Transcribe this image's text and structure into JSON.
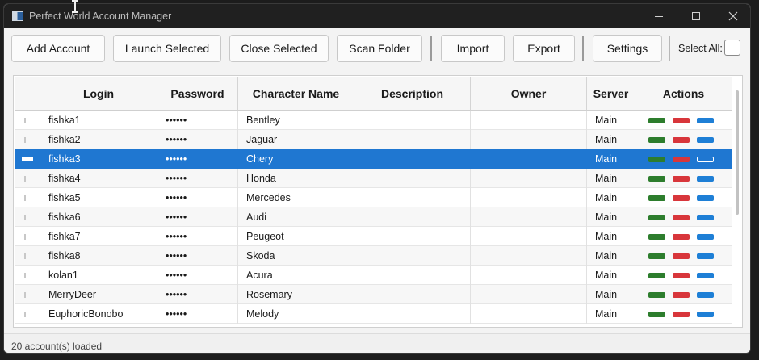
{
  "window": {
    "title": "Perfect World Account Manager"
  },
  "toolbar": {
    "add_account": "Add Account",
    "launch_selected": "Launch Selected",
    "close_selected": "Close Selected",
    "scan_folder": "Scan Folder",
    "import": "Import",
    "export": "Export",
    "settings": "Settings",
    "select_all_label": "Select All:",
    "select_all_checked": false
  },
  "table": {
    "columns": [
      "",
      "Login",
      "Password",
      "Character Name",
      "Description",
      "Owner",
      "Server",
      "Actions"
    ],
    "selected_row": 2,
    "rows": [
      {
        "login": "fishka1",
        "password": "••••••",
        "character": "Bentley",
        "description": "",
        "owner": "",
        "server": "Main"
      },
      {
        "login": "fishka2",
        "password": "••••••",
        "character": "Jaguar",
        "description": "",
        "owner": "",
        "server": "Main"
      },
      {
        "login": "fishka3",
        "password": "••••••",
        "character": "Chery",
        "description": "",
        "owner": "",
        "server": "Main"
      },
      {
        "login": "fishka4",
        "password": "••••••",
        "character": "Honda",
        "description": "",
        "owner": "",
        "server": "Main"
      },
      {
        "login": "fishka5",
        "password": "••••••",
        "character": "Mercedes",
        "description": "",
        "owner": "",
        "server": "Main"
      },
      {
        "login": "fishka6",
        "password": "••••••",
        "character": "Audi",
        "description": "",
        "owner": "",
        "server": "Main"
      },
      {
        "login": "fishka7",
        "password": "••••••",
        "character": "Peugeot",
        "description": "",
        "owner": "",
        "server": "Main"
      },
      {
        "login": "fishka8",
        "password": "••••••",
        "character": "Skoda",
        "description": "",
        "owner": "",
        "server": "Main"
      },
      {
        "login": "kolan1",
        "password": "••••••",
        "character": "Acura",
        "description": "",
        "owner": "",
        "server": "Main"
      },
      {
        "login": "MerryDeer",
        "password": "••••••",
        "character": "Rosemary",
        "description": "",
        "owner": "",
        "server": "Main"
      },
      {
        "login": "EuphoricBonobo",
        "password": "••••••",
        "character": "Melody",
        "description": "",
        "owner": "",
        "server": "Main"
      }
    ],
    "action_colors": {
      "launch": "#2d7d2d",
      "close": "#d8363b",
      "edit": "#1e7fd6"
    },
    "selection_color": "#1f77d1"
  },
  "status": {
    "text": "20 account(s) loaded"
  }
}
